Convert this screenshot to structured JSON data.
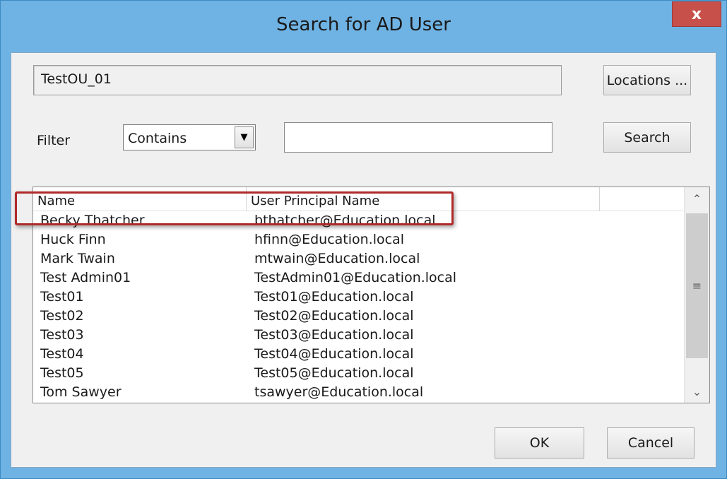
{
  "window": {
    "title": "Search for AD User",
    "close_symbol": "x"
  },
  "location": {
    "value": "TestOU_01",
    "button_label": "Locations ..."
  },
  "filter": {
    "label": "Filter",
    "mode": "Contains",
    "query": "",
    "search_label": "Search"
  },
  "list": {
    "columns": [
      "Name",
      "User Principal Name",
      ""
    ],
    "rows": [
      {
        "name": "Becky Thatcher",
        "upn": "bthatcher@Education.local"
      },
      {
        "name": "Huck Finn",
        "upn": "hfinn@Education.local"
      },
      {
        "name": "Mark Twain",
        "upn": "mtwain@Education.local"
      },
      {
        "name": "Test Admin01",
        "upn": "TestAdmin01@Education.local"
      },
      {
        "name": "Test01",
        "upn": "Test01@Education.local"
      },
      {
        "name": "Test02",
        "upn": "Test02@Education.local"
      },
      {
        "name": "Test03",
        "upn": "Test03@Education.local"
      },
      {
        "name": "Test04",
        "upn": "Test04@Education.local"
      },
      {
        "name": "Test05",
        "upn": "Test05@Education.local"
      },
      {
        "name": "Tom Sawyer",
        "upn": "tsawyer@Education.local"
      }
    ],
    "highlighted_row": "Mark Twain"
  },
  "footer": {
    "ok_label": "OK",
    "cancel_label": "Cancel"
  },
  "colors": {
    "title_bar": "#6fb3e4",
    "close_button": "#c7504a",
    "highlight_box": "#b02a2a"
  }
}
